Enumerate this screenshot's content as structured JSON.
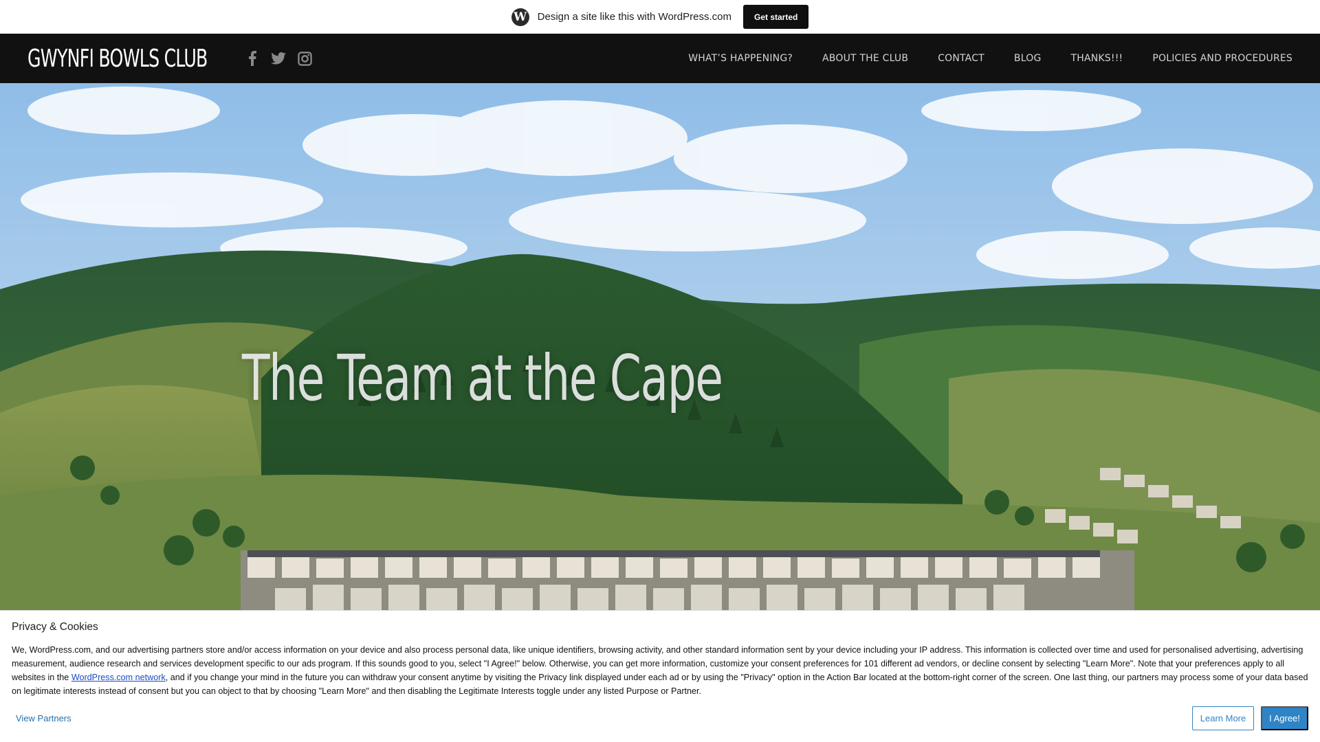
{
  "wp_bar": {
    "logo": "wordpress-logo-icon",
    "text": "Design a site like this with WordPress.com",
    "button": "Get started"
  },
  "header": {
    "site_title": "GWYNFI BOWLS CLUB",
    "social_icons": [
      "facebook-icon",
      "twitter-icon",
      "instagram-icon"
    ],
    "nav": [
      "WHAT’S HAPPENING?",
      "ABOUT THE CLUB",
      "CONTACT",
      "BLOG",
      "THANKS!!!",
      "POLICIES AND PROCEDURES"
    ]
  },
  "hero": {
    "title": "The Team at the Cape"
  },
  "cookie": {
    "title": "Privacy & Cookies",
    "body_before_link": "We, WordPress.com, and our advertising partners store and/or access information on your device and also process personal data, like unique identifiers, browsing activity, and other standard information sent by your device including your IP address. This information is collected over time and used for personalised advertising, advertising measurement, audience research and services development specific to our ads program. If this sounds good to you, select \"I Agree!\" below. Otherwise, you can get more information, customize your consent preferences for 101 different ad vendors, or decline consent by selecting \"Learn More\". Note that your preferences apply to all websites in the ",
    "link_text": "WordPress.com network",
    "body_after_link": ", and if you change your mind in the future you can withdraw your consent anytime by visiting the Privacy link displayed under each ad or by using the \"Privacy\" option in the Action Bar located at the bottom-right corner of the screen. One last thing, our partners may process some of your data based on legitimate interests instead of consent but you can object to that by choosing \"Learn More\" and then disabling the Legitimate Interests toggle under any listed Purpose or Partner.",
    "view_partners": "View Partners",
    "learn_more": "Learn More",
    "agree": "I Agree!"
  },
  "colors": {
    "header_bg": "#111111",
    "accent_blue": "#2f84c6"
  }
}
